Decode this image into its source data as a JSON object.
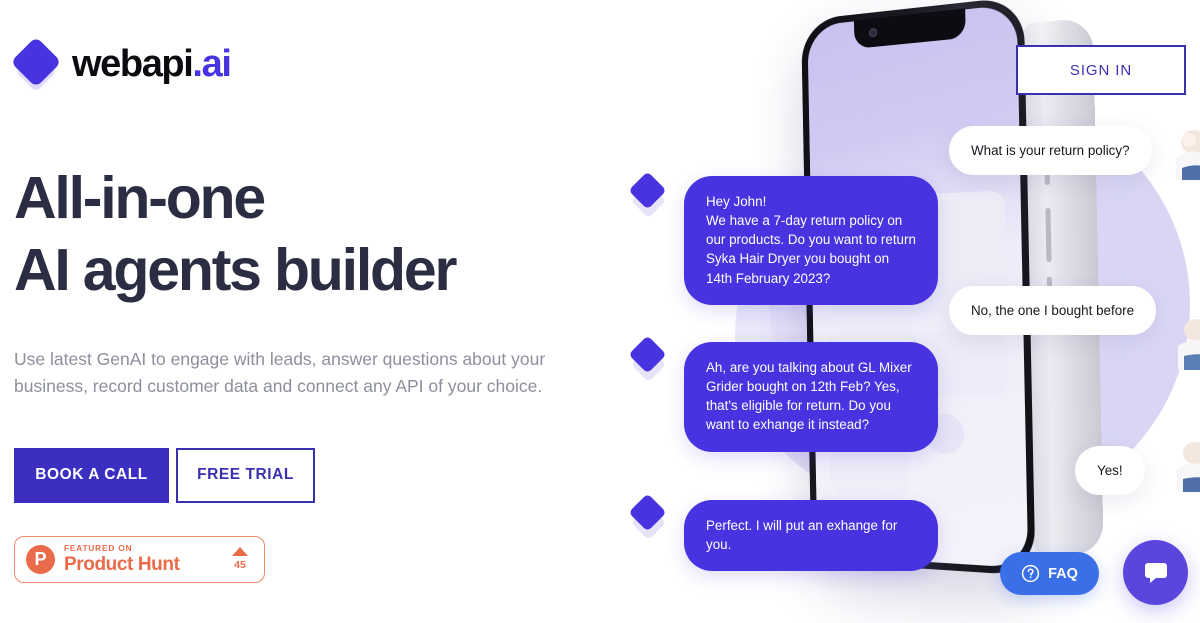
{
  "header": {
    "logo": {
      "name_main": "webapi",
      "name_accent": ".ai",
      "mark_icon": "diamond-logo-icon"
    },
    "signin_label": "SIGN IN"
  },
  "hero": {
    "headline_line1": "All-in-one",
    "headline_line2": "AI agents builder",
    "subtitle": "Use latest GenAI to engage with leads, answer questions about your business, record customer data and connect any API of your choice.",
    "primary_cta": "BOOK A CALL",
    "secondary_cta": "FREE TRIAL"
  },
  "product_hunt": {
    "logo_letter": "P",
    "featured_label": "FEATURED ON",
    "name": "Product Hunt",
    "upvote_count": "45",
    "arrow_icon": "upvote-triangle-icon"
  },
  "chat": {
    "bot_messages": [
      "Hey John!\nWe have a 7-day return policy on our products. Do you want to return Syka Hair Dryer you bought on 14th February 2023?",
      "Ah, are you talking about GL Mixer Grider bought on 12th Feb? Yes, that's eligible for return. Do you want to exhange it instead?",
      "Perfect. I will put an exhange for you."
    ],
    "user_messages": [
      "What is your return policy?",
      "No, the one I bought before",
      "Yes!"
    ],
    "avatar_icon": "diamond-avatar-icon"
  },
  "widgets": {
    "faq_label": "FAQ",
    "faq_icon": "question-circle-icon",
    "chat_icon": "chat-bubble-icon"
  },
  "colors": {
    "brand_purple": "#4733e0",
    "brand_deep": "#3a2fc0",
    "headline": "#2b2d42",
    "muted_text": "#8d909c",
    "product_hunt_orange": "#ea6b4a",
    "faq_blue": "#3b6fe8",
    "chat_widget_purple": "#5a46dd"
  }
}
